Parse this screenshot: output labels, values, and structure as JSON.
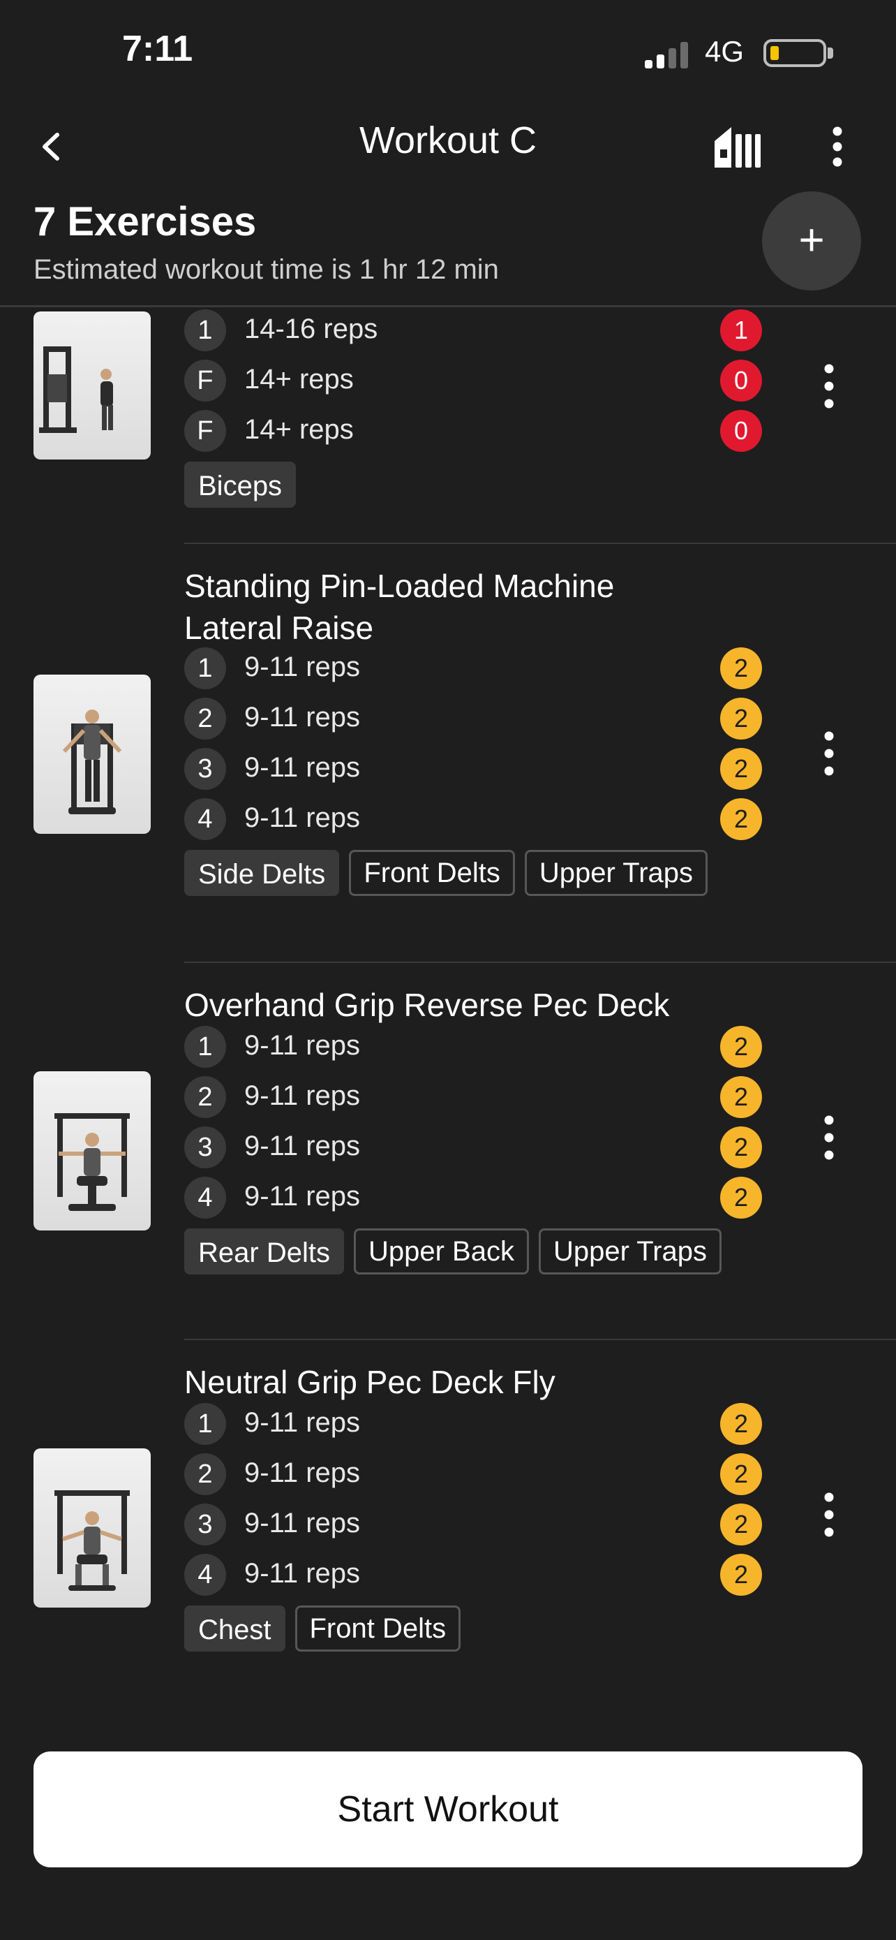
{
  "status_bar": {
    "time": "7:11",
    "network": "4G"
  },
  "nav": {
    "title": "Workout C"
  },
  "header": {
    "exercise_count": "7 Exercises",
    "estimate": "Estimated workout time is 1 hr 12 min",
    "add_label": "+"
  },
  "colors": {
    "rir_red": "#e1192f",
    "rir_yellow": "#f7b52b",
    "background": "#1e1e1e"
  },
  "exercises": [
    {
      "name": "",
      "sets": [
        {
          "num": "1",
          "reps": "14-16 reps",
          "rir": "1",
          "rir_color": "red"
        },
        {
          "num": "F",
          "reps": "14+ reps",
          "rir": "0",
          "rir_color": "red"
        },
        {
          "num": "F",
          "reps": "14+ reps",
          "rir": "0",
          "rir_color": "red"
        }
      ],
      "tags": [
        {
          "label": "Biceps",
          "primary": true
        }
      ]
    },
    {
      "name_line1": "Standing Pin-Loaded Machine",
      "name_line2": "Lateral Raise",
      "sets": [
        {
          "num": "1",
          "reps": "9-11 reps",
          "rir": "2",
          "rir_color": "yellow"
        },
        {
          "num": "2",
          "reps": "9-11 reps",
          "rir": "2",
          "rir_color": "yellow"
        },
        {
          "num": "3",
          "reps": "9-11 reps",
          "rir": "2",
          "rir_color": "yellow"
        },
        {
          "num": "4",
          "reps": "9-11 reps",
          "rir": "2",
          "rir_color": "yellow"
        }
      ],
      "tags": [
        {
          "label": "Side Delts",
          "primary": true
        },
        {
          "label": "Front Delts",
          "primary": false
        },
        {
          "label": "Upper Traps",
          "primary": false
        }
      ]
    },
    {
      "name": "Overhand Grip Reverse Pec Deck",
      "sets": [
        {
          "num": "1",
          "reps": "9-11 reps",
          "rir": "2",
          "rir_color": "yellow"
        },
        {
          "num": "2",
          "reps": "9-11 reps",
          "rir": "2",
          "rir_color": "yellow"
        },
        {
          "num": "3",
          "reps": "9-11 reps",
          "rir": "2",
          "rir_color": "yellow"
        },
        {
          "num": "4",
          "reps": "9-11 reps",
          "rir": "2",
          "rir_color": "yellow"
        }
      ],
      "tags": [
        {
          "label": "Rear Delts",
          "primary": true
        },
        {
          "label": "Upper Back",
          "primary": false
        },
        {
          "label": "Upper Traps",
          "primary": false
        }
      ]
    },
    {
      "name": "Neutral Grip Pec Deck Fly",
      "sets": [
        {
          "num": "1",
          "reps": "9-11 reps",
          "rir": "2",
          "rir_color": "yellow"
        },
        {
          "num": "2",
          "reps": "9-11 reps",
          "rir": "2",
          "rir_color": "yellow"
        },
        {
          "num": "3",
          "reps": "9-11 reps",
          "rir": "2",
          "rir_color": "yellow"
        },
        {
          "num": "4",
          "reps": "9-11 reps",
          "rir": "2",
          "rir_color": "yellow"
        }
      ],
      "tags": [
        {
          "label": "Chest",
          "primary": true
        },
        {
          "label": "Front Delts",
          "primary": false
        }
      ]
    }
  ],
  "footer": {
    "start_label": "Start Workout"
  }
}
